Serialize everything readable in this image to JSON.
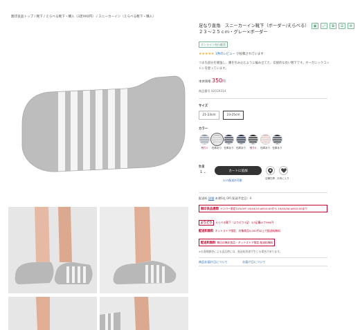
{
  "breadcrumb": "無印良品トップ / 靴下 / えらべる靴下・購入（3足990円） / スニーカーイン（えらべる靴下・購入）",
  "product": {
    "title": "足なり直角　スニーカーイン靴下（ボーダー/えらべる）　２３～２５ｃｍ・グレー×ボーダー",
    "badge": "オンライン先行販売",
    "stars": "★★★★★",
    "review_link": "1件のレビュー",
    "review_text": "が投稿されています",
    "description": "つま先部分を補強し、踵を包み込むように編み立てた、伝統的な長い靴下です。オーガニックコットンを使っています。",
    "price_prefix": "本体価格",
    "price": "350",
    "price_unit": "円",
    "product_id": "商品番号 82029314"
  },
  "toolbar": {
    "icons": [
      "bookmark-icon",
      "share-icon",
      "copy-icon",
      "list-icon",
      "settings-icon"
    ]
  },
  "size": {
    "label": "サイズ",
    "options": [
      "21-23cm",
      "23-25cm"
    ],
    "selected": "23-25cm"
  },
  "color": {
    "label": "カラー",
    "swatches": [
      {
        "label": "残り1",
        "red": true,
        "bg": "#8b96a8",
        "stripe": "#ffffff"
      },
      {
        "label": "在庫あり",
        "red": false,
        "bg": "#c5c5c5",
        "stripe": "#ffffff"
      },
      {
        "label": "在庫あり",
        "red": false,
        "bg": "#2c3550",
        "stripe": "#ffffff"
      },
      {
        "label": "在庫あり",
        "red": false,
        "bg": "#1e2a44",
        "stripe": "#e8e8e8"
      },
      {
        "label": "残り5",
        "red": true,
        "bg": "#222222",
        "stripe": "#ffffff"
      },
      {
        "label": "在庫あり",
        "red": false,
        "bg": "#e8c4bf",
        "stripe": "#ffffff"
      },
      {
        "label": "在庫あり",
        "red": false,
        "bg": "#2a2f3e",
        "stripe": "#ffffff"
      }
    ]
  },
  "cart": {
    "qty_label": "数量",
    "qty_value": "1",
    "button": "カートに追加",
    "store_stock": "店舗在庫",
    "favorite": "お気に入り",
    "sub_link": "3/13配送お可能"
  },
  "shipping": {
    "text_a": "配送料",
    "link": "詳細",
    "text_b": "未満5社 0円",
    "text_c": "配送予定日：4"
  },
  "promos": [
    {
      "tag": "無印良品週間",
      "text": "メンバー限定10%OFF 19/04/19 AM10:00から 19/05/06 AM10:00まで"
    },
    {
      "tag": "よりどり",
      "text": "えらべる靴下（よりどり3足）3/3足購入で990円"
    },
    {
      "tag": "配送料無料",
      "text": "ネットストア限定、対象商品5,000円以上で配送料無料"
    },
    {
      "tag": "配送料無料",
      "text": "毎日の無印良品・ネットストア限定 配送料無料"
    }
  ],
  "note": "※お客様都合による返品時には、配送料別途が生じる場合があります。",
  "links": [
    "商品お届け日について",
    "お届け日について"
  ]
}
